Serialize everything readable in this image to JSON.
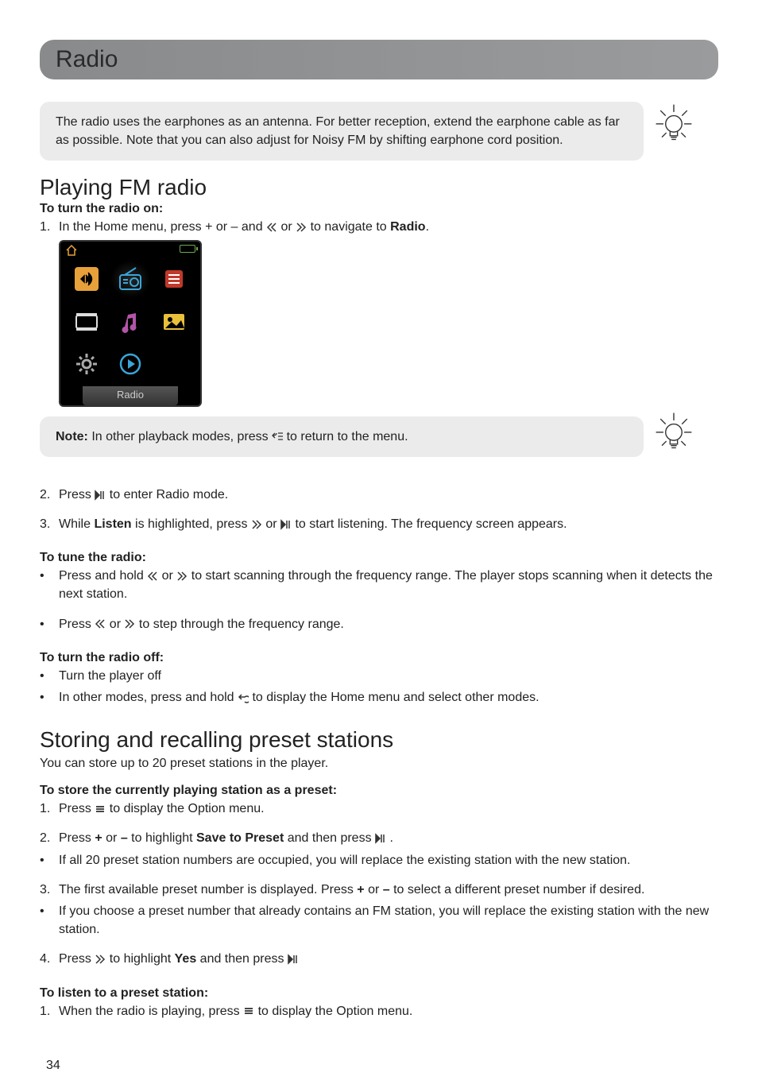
{
  "header": {
    "title": "Radio"
  },
  "tip1": "The radio uses the earphones as an antenna. For better reception, extend the earphone cable as far as possible. Note that you can also adjust for Noisy FM by shifting earphone cord position.",
  "section_playing": {
    "heading": "Playing FM radio",
    "turn_on_label": "To turn the radio on:",
    "step1_num": "1.",
    "step1_a": "In the Home menu, press + or – and ",
    "step1_or": " or ",
    "step1_b": " to navigate to ",
    "step1_bold": "Radio",
    "step1_end": "."
  },
  "device": {
    "label": "Radio"
  },
  "note": {
    "prefix": "Note:",
    "a": " In other playback modes, press ",
    "b": " to return to the menu."
  },
  "steps_after": {
    "s2_num": "2.",
    "s2_a": "Press ",
    "s2_b": " to enter Radio mode.",
    "s3_num": "3.",
    "s3_a": "While ",
    "s3_bold": "Listen",
    "s3_b": " is highlighted, press ",
    "s3_or": " or ",
    "s3_c": " to start listening. The frequency screen appears."
  },
  "tune": {
    "label": "To tune the radio:",
    "b1_a": "Press and hold ",
    "b1_or": " or ",
    "b1_b": " to start scanning through the frequency range. The player stops scanning when it detects the next station.",
    "b2_a": "Press ",
    "b2_or": " or ",
    "b2_b": " to step through the frequency range."
  },
  "turn_off": {
    "label": "To turn the radio off:",
    "b1": "Turn the player off",
    "b2_a": "In other modes, press and hold ",
    "b2_b": " to display the Home menu and select other modes."
  },
  "section_preset": {
    "heading": "Storing and recalling preset stations",
    "intro": "You can store up to 20 preset stations in the player.",
    "store_label": "To store the currently playing station as a preset:",
    "s1_num": "1.",
    "s1_a": "Press ",
    "s1_b": " to display the Option menu.",
    "s2_num": "2.",
    "s2_a": "Press ",
    "s2_plus": "+",
    "s2_or": " or ",
    "s2_minus": "–",
    "s2_b": " to highlight ",
    "s2_bold": "Save to Preset",
    "s2_c": " and then press ",
    "s2_end": " .",
    "s2_bullet": "If all 20 preset station numbers are occupied, you will replace the existing station with the new station.",
    "s3_num": "3.",
    "s3_a": "The first available preset number is displayed. Press ",
    "s3_plus": "+",
    "s3_or": " or ",
    "s3_minus": "–",
    "s3_b": " to select a different preset number if desired.",
    "s3_bullet": "If you choose a preset number that already contains an FM station, you will replace the existing station with the new station.",
    "s4_num": "4.",
    "s4_a": "Press ",
    "s4_b": " to highlight ",
    "s4_bold": "Yes",
    "s4_c": " and then press ",
    "listen_label": "To listen to a preset station:",
    "l1_num": "1.",
    "l1_a": "When the radio is playing, press ",
    "l1_b": " to display the Option menu."
  },
  "page": "34"
}
